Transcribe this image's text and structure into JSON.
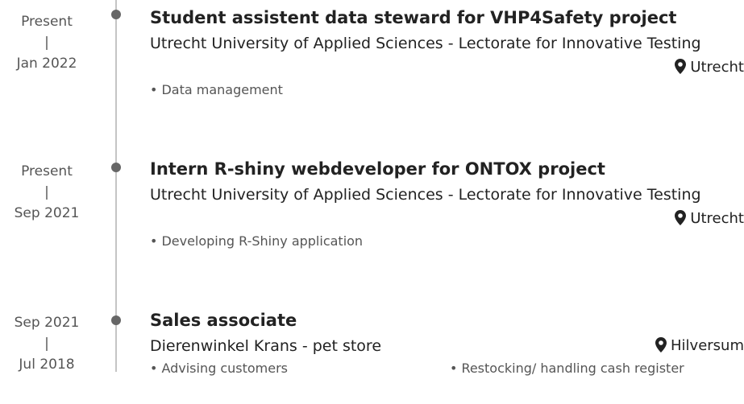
{
  "entries": [
    {
      "date_end": "Present",
      "date_sep": "|",
      "date_start": "Jan 2022",
      "title": "Student assistent data steward for VHP4Safety project",
      "organization": "Utrecht University of Applied Sciences - Lectorate for Innovative Testing",
      "location": "Utrecht",
      "bullets": [
        "Data management"
      ]
    },
    {
      "date_end": "Present",
      "date_sep": "|",
      "date_start": "Sep 2021",
      "title": "Intern R-shiny webdeveloper for ONTOX project",
      "organization": "Utrecht University of Applied Sciences - Lectorate for Innovative Testing",
      "location": "Utrecht",
      "bullets": [
        "Developing R-Shiny application"
      ]
    },
    {
      "date_end": "Sep 2021",
      "date_sep": "|",
      "date_start": "Jul 2018",
      "title": "Sales associate",
      "organization": "Dierenwinkel Krans - pet store",
      "location": "Hilversum",
      "bullets": [
        "Advising customers",
        "Restocking/ handling cash register"
      ]
    }
  ],
  "bullet_char": "•",
  "icons": {
    "location": "map-marker-icon"
  },
  "colors": {
    "text": "#222222",
    "muted": "#555555",
    "timeline": "#c4c4c4",
    "dot": "#666666"
  }
}
